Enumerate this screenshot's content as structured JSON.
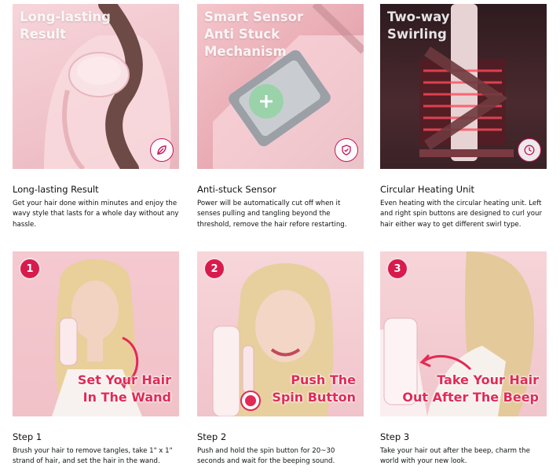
{
  "features": [
    {
      "overlay_line1": "Long-lasting",
      "overlay_line2": "Result",
      "icon": "leaf-icon",
      "title": "Long-lasting Result",
      "desc": "Get your hair done within minutes and enjoy the wavy style that lasts for a whole day without any hassle."
    },
    {
      "overlay_line1": "Smart Sensor",
      "overlay_line2": "Anti Stuck",
      "overlay_line3": "Mechanism",
      "icon": "shield-icon",
      "title": "Anti-stuck Sensor",
      "desc": "Power will be automatically cut off when it senses pulling and tangling beyond the threshold, remove the hair refore restarting."
    },
    {
      "overlay_line1": "Two-way",
      "overlay_line2": "Swirling",
      "icon": "clock-icon",
      "title": "Circular Heating Unit",
      "desc": "Even heating with the circular heating unit. Left and right spin buttons are designed to curl your hair either way to get different swirl type."
    }
  ],
  "steps": [
    {
      "number": "1",
      "text_line1": "Set Your Hair",
      "text_line2": "In The Wand",
      "title": "Step 1",
      "desc": "Brush your hair to remove tangles, take 1\" x 1\" strand of hair, and set the hair in the wand."
    },
    {
      "number": "2",
      "text_line1": "Push The",
      "text_line2": "Spin Button",
      "title": "Step 2",
      "desc": "Push and hold the spin button for 20~30 seconds and wait for the beeping sound."
    },
    {
      "number": "3",
      "text_line1": "Take Your Hair",
      "text_line2": "Out After The Beep",
      "title": "Step 3",
      "desc": "Take your hair out after the beep, charm the world with your new look."
    }
  ],
  "colors": {
    "accent": "#e22a55",
    "pink_bg": "#f3c9cf",
    "dark_bg": "#3a2226"
  }
}
